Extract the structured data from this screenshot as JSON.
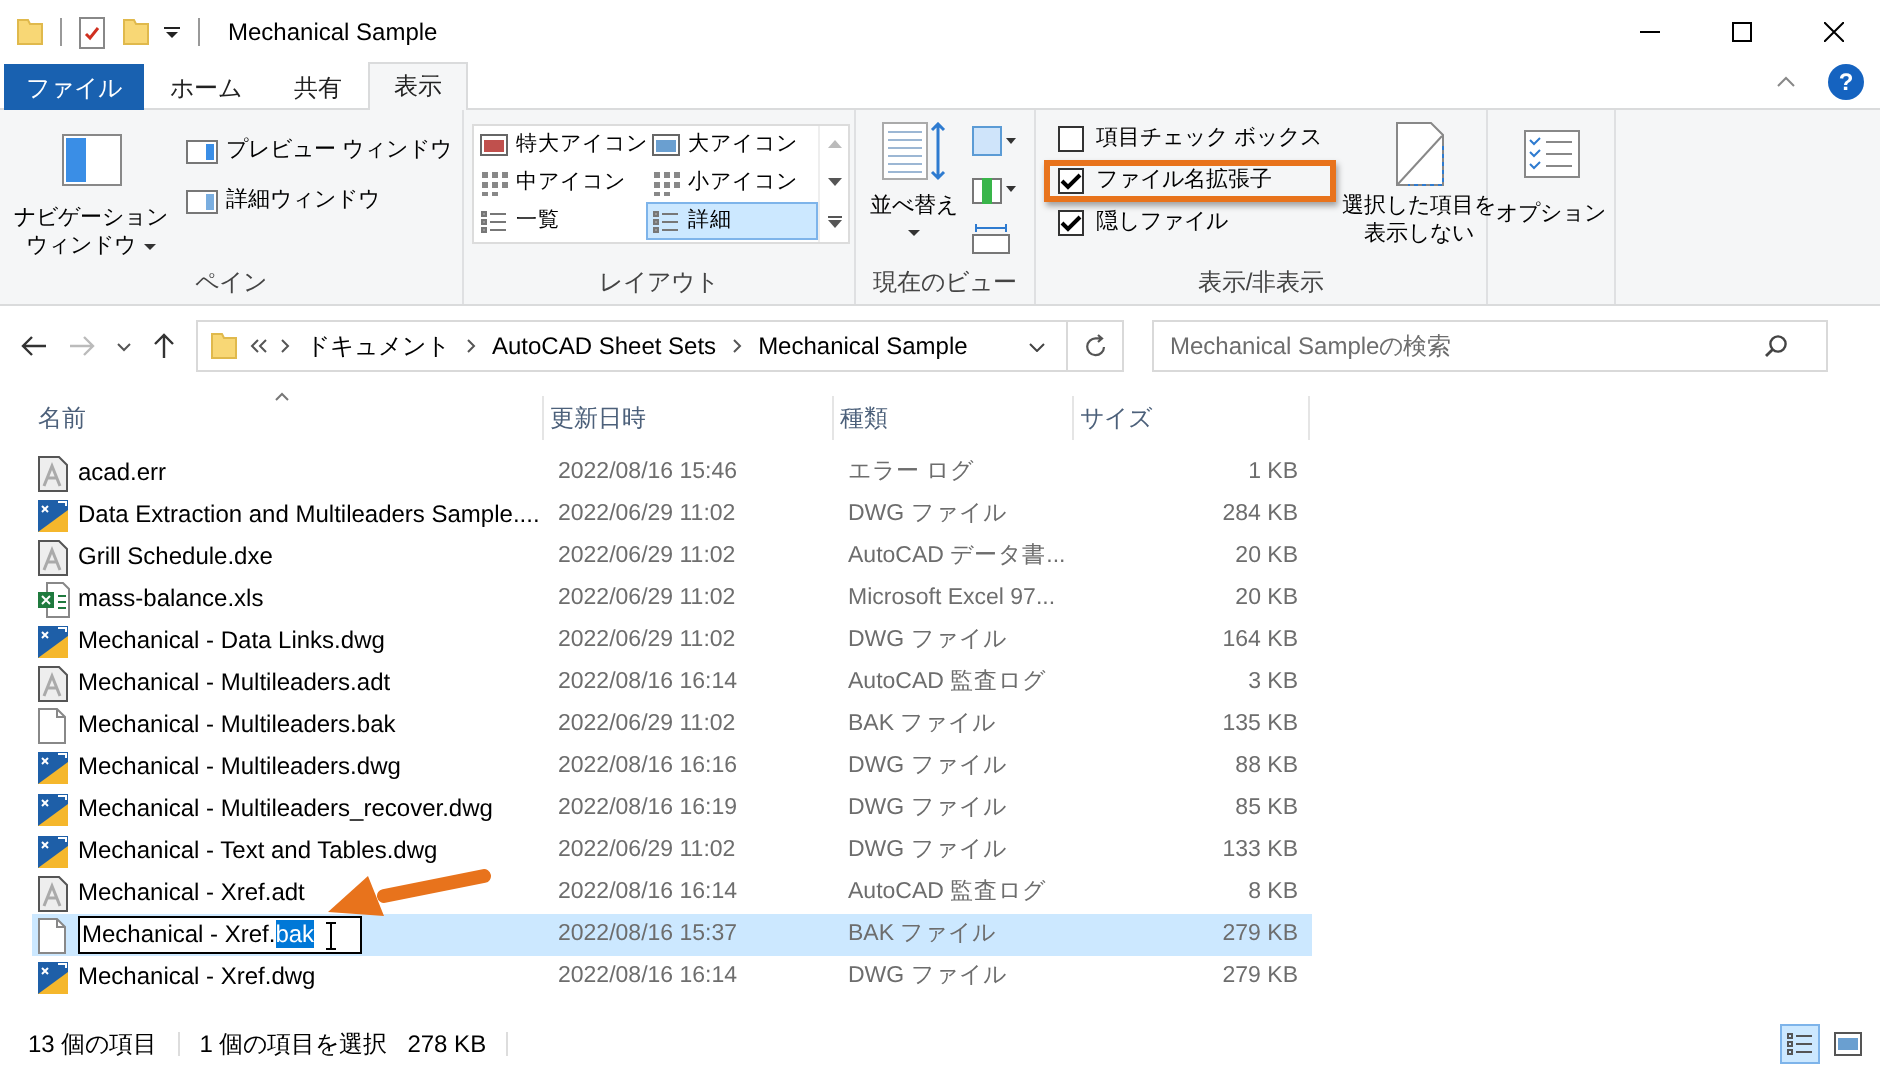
{
  "window": {
    "title": "Mechanical Sample"
  },
  "ribbon_tabs": [
    {
      "label": "ファイル",
      "kind": "file",
      "selected": false
    },
    {
      "label": "ホーム",
      "kind": "tab",
      "selected": false
    },
    {
      "label": "共有",
      "kind": "tab",
      "selected": false
    },
    {
      "label": "表示",
      "kind": "tab",
      "selected": true
    }
  ],
  "help": "?",
  "pane_group": {
    "label": "ペイン",
    "navigation_lines": [
      "ナビゲーション",
      "ウィンドウ"
    ],
    "items": [
      "プレビュー ウィンドウ",
      "詳細ウィンドウ"
    ]
  },
  "layout_group": {
    "label": "レイアウト",
    "items": [
      {
        "label": "特大アイコン",
        "selected": false
      },
      {
        "label": "大アイコン",
        "selected": false
      },
      {
        "label": "中アイコン",
        "selected": false
      },
      {
        "label": "小アイコン",
        "selected": false
      },
      {
        "label": "一覧",
        "selected": false
      },
      {
        "label": "詳細",
        "selected": true
      }
    ]
  },
  "view_group": {
    "label": "現在のビュー",
    "sort": "並べ替え"
  },
  "show_hide_group": {
    "label": "表示/非表示",
    "checkboxes": [
      {
        "label": "項目チェック ボックス",
        "checked": false,
        "highlighted": false
      },
      {
        "label": "ファイル名拡張子",
        "checked": true,
        "highlighted": true
      },
      {
        "label": "隠しファイル",
        "checked": true,
        "highlighted": false
      }
    ],
    "hide_selected_lines": [
      "選択した項目を",
      "表示しない"
    ]
  },
  "options_group": {
    "label": "オプション"
  },
  "address": {
    "breadcrumb": [
      "ドキュメント",
      "AutoCAD Sheet Sets",
      "Mechanical Sample"
    ]
  },
  "search": {
    "placeholder": "Mechanical Sampleの検索"
  },
  "columns": [
    "名前",
    "更新日時",
    "種類",
    "サイズ"
  ],
  "rows": [
    {
      "kind": "audit",
      "name": "acad.err",
      "date": "2022/08/16 15:46",
      "type": "エラー ログ",
      "size": "1 KB",
      "selected": false,
      "editing": false
    },
    {
      "kind": "dwg",
      "name": "Data Extraction and Multileaders Sample....",
      "date": "2022/06/29 11:02",
      "type": "DWG ファイル",
      "size": "284 KB",
      "selected": false,
      "editing": false
    },
    {
      "kind": "audit",
      "name": "Grill Schedule.dxe",
      "date": "2022/06/29 11:02",
      "type": "AutoCAD データ書...",
      "size": "20 KB",
      "selected": false,
      "editing": false
    },
    {
      "kind": "excel",
      "name": "mass-balance.xls",
      "date": "2022/06/29 11:02",
      "type": "Microsoft Excel 97...",
      "size": "20 KB",
      "selected": false,
      "editing": false
    },
    {
      "kind": "dwg",
      "name": "Mechanical - Data Links.dwg",
      "date": "2022/06/29 11:02",
      "type": "DWG ファイル",
      "size": "164 KB",
      "selected": false,
      "editing": false
    },
    {
      "kind": "audit",
      "name": "Mechanical - Multileaders.adt",
      "date": "2022/08/16 16:14",
      "type": "AutoCAD 監査ログ",
      "size": "3 KB",
      "selected": false,
      "editing": false
    },
    {
      "kind": "blank",
      "name": "Mechanical - Multileaders.bak",
      "date": "2022/06/29 11:02",
      "type": "BAK ファイル",
      "size": "135 KB",
      "selected": false,
      "editing": false
    },
    {
      "kind": "dwg",
      "name": "Mechanical - Multileaders.dwg",
      "date": "2022/08/16 16:16",
      "type": "DWG ファイル",
      "size": "88 KB",
      "selected": false,
      "editing": false
    },
    {
      "kind": "dwg",
      "name": "Mechanical - Multileaders_recover.dwg",
      "date": "2022/08/16 16:19",
      "type": "DWG ファイル",
      "size": "85 KB",
      "selected": false,
      "editing": false
    },
    {
      "kind": "dwg",
      "name": "Mechanical - Text and Tables.dwg",
      "date": "2022/06/29 11:02",
      "type": "DWG ファイル",
      "size": "133 KB",
      "selected": false,
      "editing": false
    },
    {
      "kind": "audit",
      "name": "Mechanical - Xref.adt",
      "date": "2022/08/16 16:14",
      "type": "AutoCAD 監査ログ",
      "size": "8 KB",
      "selected": false,
      "editing": false
    },
    {
      "kind": "blank",
      "name": "Mechanical - Xref.",
      "name_selection": "bak",
      "date": "2022/08/16 15:37",
      "type": "BAK ファイル",
      "size": "279 KB",
      "selected": true,
      "editing": true
    },
    {
      "kind": "dwg",
      "name": "Mechanical - Xref.dwg",
      "date": "2022/08/16 16:14",
      "type": "DWG ファイル",
      "size": "279 KB",
      "selected": false,
      "editing": false
    }
  ],
  "status_bar": {
    "count": "13 個の項目",
    "selection": "1 個の項目を選択",
    "selection_size": "278 KB",
    "view_buttons": [
      {
        "kind": "details",
        "selected": true
      },
      {
        "kind": "large-icons",
        "selected": false
      }
    ]
  }
}
